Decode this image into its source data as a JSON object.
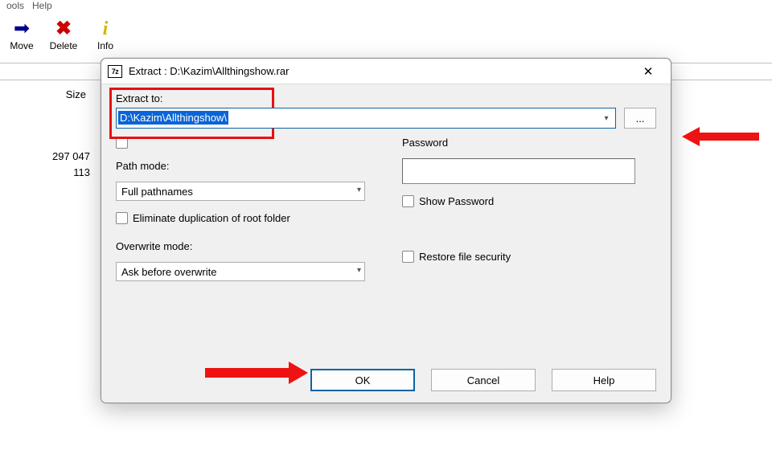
{
  "menu": {
    "tools": "ools",
    "help": "Help"
  },
  "toolbar": {
    "move": {
      "label": "Move"
    },
    "delete": {
      "label": "Delete"
    },
    "info": {
      "label": "Info"
    }
  },
  "filelist": {
    "size_header": "Size",
    "rows": [
      "297 047",
      "113"
    ]
  },
  "dialog": {
    "app_icon_text": "7z",
    "title": "Extract : D:\\Kazim\\Allthingshow.rar",
    "extract_to_label": "Extract to:",
    "extract_to_value": "D:\\Kazim\\Allthingshow\\",
    "browse_label": "...",
    "path_mode_label": "Path mode:",
    "path_mode_value": "Full pathnames",
    "eliminate_dup_label": "Eliminate duplication of root folder",
    "overwrite_label": "Overwrite mode:",
    "overwrite_value": "Ask before overwrite",
    "password_label": "Password",
    "show_password_label": "Show Password",
    "restore_security_label": "Restore file security",
    "ok": "OK",
    "cancel": "Cancel",
    "help": "Help"
  }
}
